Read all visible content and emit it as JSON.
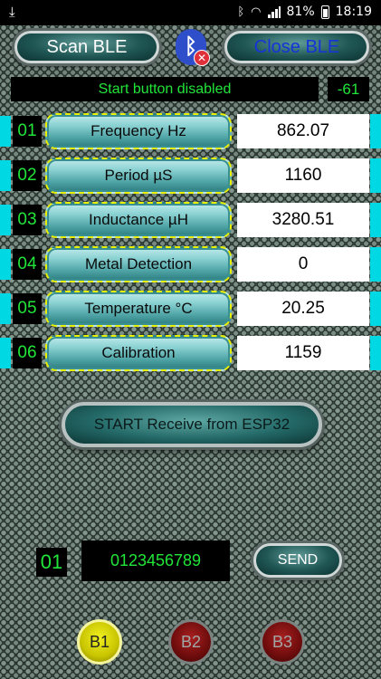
{
  "statusbar": {
    "download_icon": "download-icon",
    "battery": "81%",
    "time": "18:19"
  },
  "header": {
    "scan_label": "Scan BLE",
    "close_label": "Close BLE",
    "bluetooth_icon": "bluetooth-disconnected-icon"
  },
  "status": {
    "message": "Start button disabled",
    "rssi": "-61"
  },
  "rows": [
    {
      "num": "01",
      "label": "Frequency Hz",
      "value": "862.07"
    },
    {
      "num": "02",
      "label": "Period µS",
      "value": "1160"
    },
    {
      "num": "03",
      "label": "Inductance µH",
      "value": "3280.51"
    },
    {
      "num": "04",
      "label": "Metal Detection",
      "value": "0"
    },
    {
      "num": "05",
      "label": "Temperature °C",
      "value": "20.25"
    },
    {
      "num": "06",
      "label": "Calibration",
      "value": "1159"
    }
  ],
  "start_label": "START Receive from ESP32",
  "send": {
    "num": "01",
    "value": "0123456789",
    "button_label": "SEND"
  },
  "bottom_buttons": [
    "B1",
    "B2",
    "B3"
  ],
  "colors": {
    "accent_green": "#22e53a",
    "cyan_strip": "#00d9e4",
    "close_text": "#1533d8",
    "b1": "#e0e000",
    "b2_b3": "#7a1010"
  }
}
